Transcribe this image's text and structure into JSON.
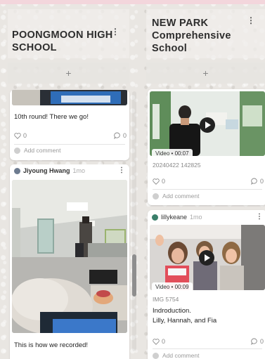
{
  "columns": [
    {
      "title_line1": "POONGMOON HIGH",
      "title_line2": "SCHOOL",
      "menu_icon": "vertical-ellipsis",
      "add_icon": "+",
      "cards": [
        {
          "caption": "10th round! There we go!",
          "likes": "0",
          "comments": "0",
          "add_comment": "Add comment"
        },
        {
          "author": "Jiyoung Hwang",
          "time": "1mo",
          "caption": "This is how we recorded!"
        }
      ]
    },
    {
      "title_line1": "NEW PARK",
      "title_line2": "Comprehensive",
      "title_line3": "School",
      "menu_icon": "vertical-ellipsis",
      "add_icon": "+",
      "cards": [
        {
          "video_label": "Video • 00:07",
          "filename": "20240422 142825",
          "likes": "0",
          "comments": "0",
          "add_comment": "Add comment"
        },
        {
          "author": "lillykeane",
          "time": "1mo",
          "video_label": "Video • 00:09",
          "filename": "IMG 5754",
          "desc_line1": "Indroduction.",
          "desc_line2": "Lilly, Hannah, and Fia",
          "likes": "0",
          "comments": "0",
          "add_comment": "Add comment"
        }
      ]
    }
  ],
  "icons": {
    "heart": "heart-icon",
    "comment": "comment-bubble-icon",
    "play": "play-icon",
    "kebab": "kebab-menu-icon",
    "plus": "plus-icon"
  },
  "colors": {
    "accent_pink": "#f3d6dc",
    "card_bg": "#ffffff",
    "muted_text": "#9a9a9a"
  }
}
